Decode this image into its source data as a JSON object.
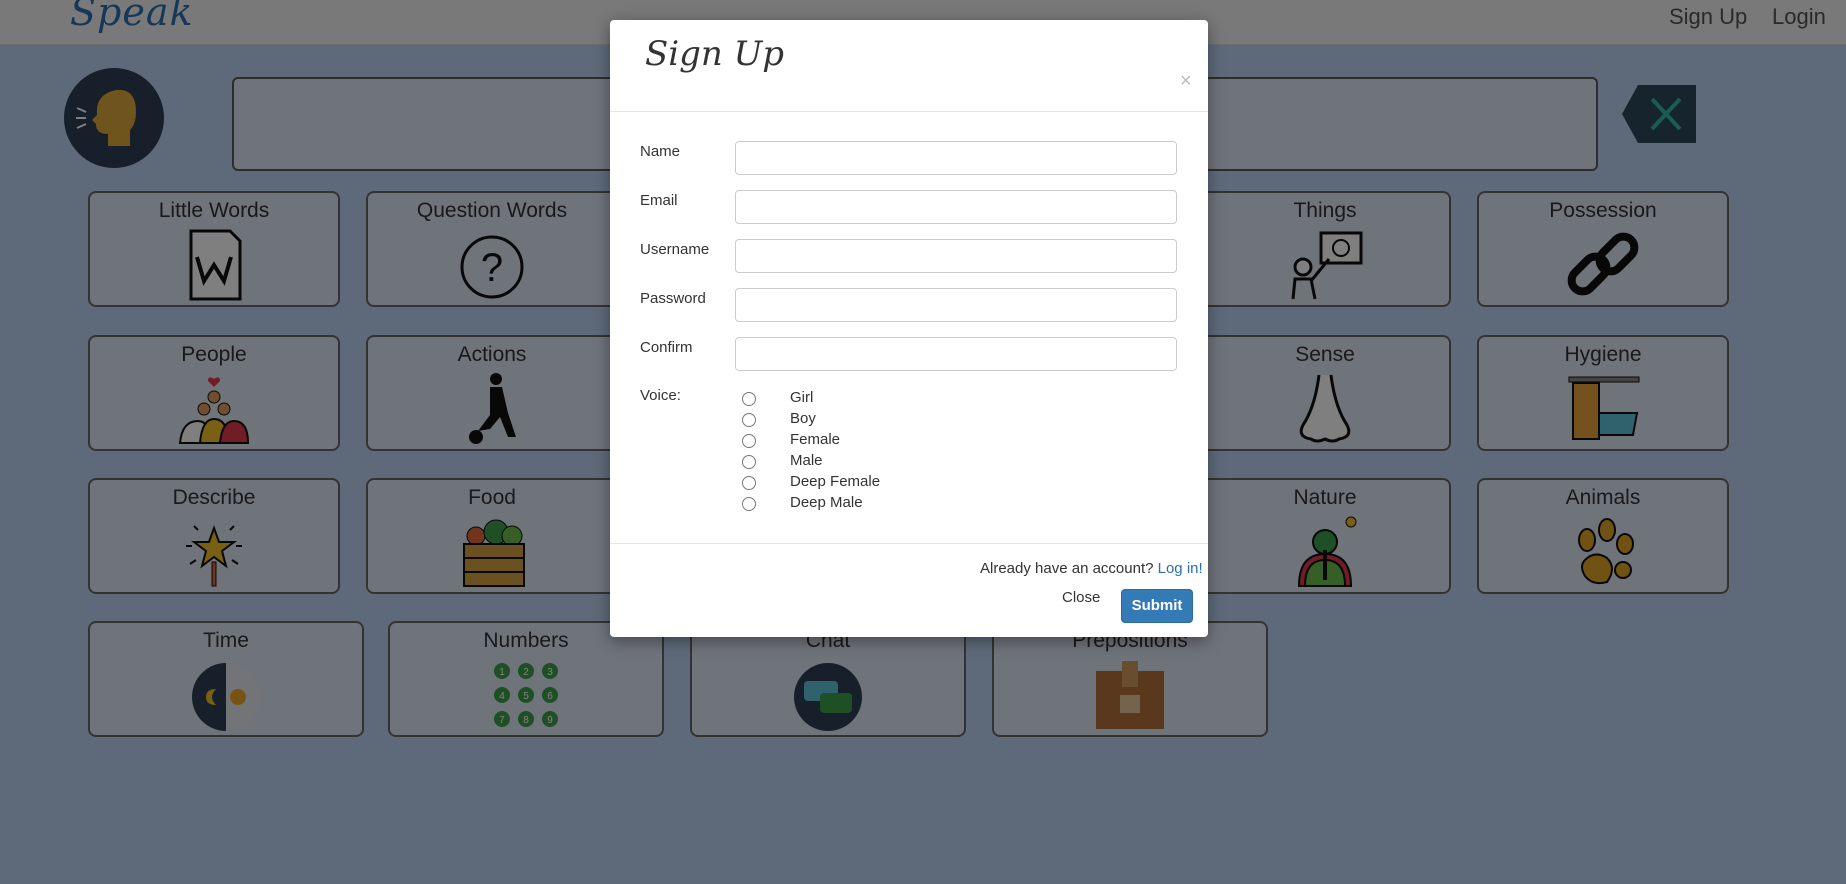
{
  "navbar": {
    "brand": "Speak",
    "links": [
      "Sign Up",
      "Login"
    ]
  },
  "tiles": [
    {
      "label": "Little Words",
      "icon": "document-w-icon"
    },
    {
      "label": "Question Words",
      "icon": "question-mark-icon"
    },
    {
      "label": "Things",
      "icon": "teacher-board-icon"
    },
    {
      "label": "Possession",
      "icon": "chain-link-icon"
    },
    {
      "label": "People",
      "icon": "people-group-icon"
    },
    {
      "label": "Actions",
      "icon": "kicking-ball-icon"
    },
    {
      "label": "Sense",
      "icon": "nose-icon"
    },
    {
      "label": "Hygiene",
      "icon": "bathtub-icon"
    },
    {
      "label": "Describe",
      "icon": "magic-wand-icon"
    },
    {
      "label": "Food",
      "icon": "vegetable-crate-icon"
    },
    {
      "label": "Nature",
      "icon": "tree-hill-icon"
    },
    {
      "label": "Animals",
      "icon": "paw-print-icon"
    },
    {
      "label": "Time",
      "icon": "day-night-icon"
    },
    {
      "label": "Numbers",
      "icon": "number-grid-icon"
    },
    {
      "label": "Chat",
      "icon": "chat-bubbles-icon"
    },
    {
      "label": "Prepositions",
      "icon": "box-icon"
    }
  ],
  "modal": {
    "title": "Sign Up",
    "close_glyph": "×",
    "fields": [
      {
        "label": "Name",
        "value": ""
      },
      {
        "label": "Email",
        "value": ""
      },
      {
        "label": "Username",
        "value": ""
      },
      {
        "label": "Password",
        "value": ""
      },
      {
        "label": "Confirm",
        "value": ""
      }
    ],
    "voice_label": "Voice:",
    "voices": [
      "Girl",
      "Boy",
      "Female",
      "Male",
      "Deep Female",
      "Deep Male"
    ],
    "login_prompt": "Already have an account?",
    "login_link": "Log in!",
    "close_label": "Close",
    "submit_label": "Submit"
  }
}
